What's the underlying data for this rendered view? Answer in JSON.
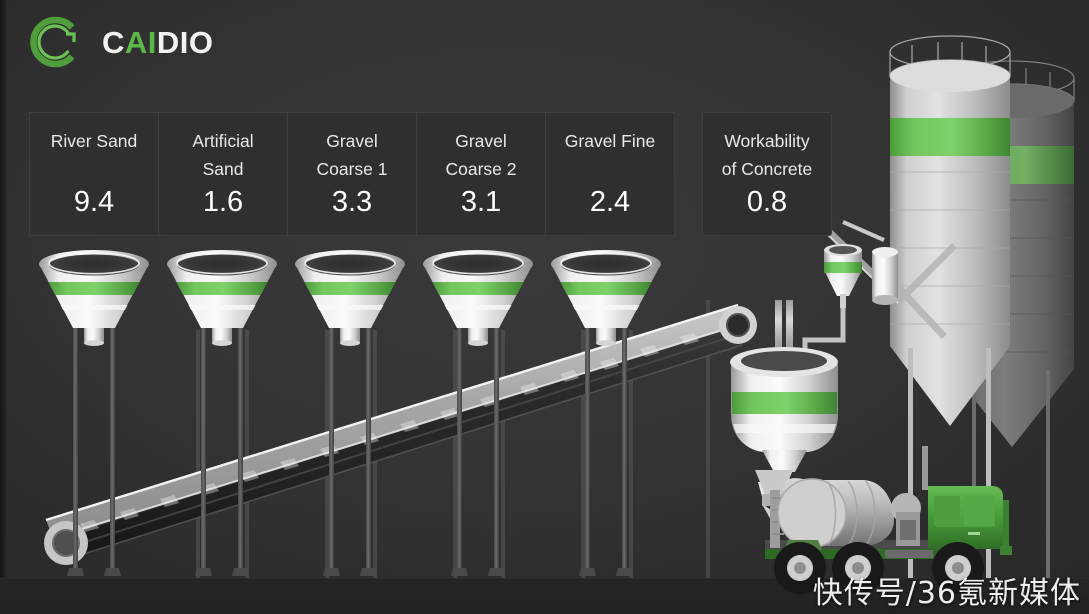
{
  "brand": {
    "logo_icon": "caidio-c-logo-icon",
    "name_part_white_1": "C",
    "name_part_green": "AI",
    "name_part_white_2": "DIO",
    "accent_color": "#5cb846",
    "text_color": "#f2f2f2"
  },
  "metrics": [
    {
      "label_line1": "River Sand",
      "label_line2": "",
      "value": "9.4",
      "hopper_icon": "funnel-hopper-icon"
    },
    {
      "label_line1": "Artificial",
      "label_line2": "Sand",
      "value": "1.6",
      "hopper_icon": "funnel-hopper-icon"
    },
    {
      "label_line1": "Gravel",
      "label_line2": "Coarse 1",
      "value": "3.3",
      "hopper_icon": "funnel-hopper-icon"
    },
    {
      "label_line1": "Gravel",
      "label_line2": "Coarse 2",
      "value": "3.1",
      "hopper_icon": "funnel-hopper-icon"
    },
    {
      "label_line1": "Gravel Fine",
      "label_line2": "",
      "value": "2.4",
      "hopper_icon": "funnel-hopper-icon"
    }
  ],
  "summary_metric": {
    "label_line1": "Workability",
    "label_line2": "of Concrete",
    "value": "0.8"
  },
  "plant": {
    "funnel_count": 5,
    "conveyor_icon": "conveyor-belt-icon",
    "mixer_icon": "mixer-tank-icon",
    "weigh_hopper_icon": "weigh-hopper-icon",
    "silo_front_icon": "cement-silo-icon",
    "silo_back_icon": "cement-silo-icon",
    "truck_icon": "concrete-mixer-truck-icon",
    "band_color": "#6cbf59",
    "metal_light": "#e8e8e8",
    "metal_mid": "#b9b9b9",
    "metal_dark": "#6e6e6e"
  },
  "watermark": {
    "text": "快传号/36氪新媒体"
  }
}
